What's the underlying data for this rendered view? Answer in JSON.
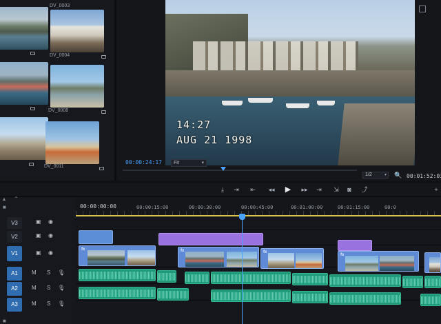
{
  "bin": {
    "items": [
      {
        "label": "",
        "image": "harbor-houses"
      },
      {
        "label": "DV_0004",
        "image": "white-houses-street"
      },
      {
        "label": "",
        "image": "harbor-boats"
      },
      {
        "label": "DV_0008",
        "image": "coastline"
      },
      {
        "label": "",
        "image": "beach-people"
      },
      {
        "label": "DV_0011",
        "image": "child-on-beach"
      }
    ],
    "top_label": "DV_0003"
  },
  "monitor": {
    "overlay_time": "14:27",
    "overlay_date": "AUG 21 1998",
    "current_timecode": "00:00:24:17",
    "zoom": "Fit",
    "quality": "1/2",
    "duration_timecode": "00:01:52:03",
    "playhead_fraction": 0.43
  },
  "timeline": {
    "current_timecode": "00:00:00:00",
    "ruler_labels": [
      "00:00:15:00",
      "00:00:30:00",
      "00:00:45:00",
      "00:01:00:00",
      "00:01:15:00",
      "00:0"
    ],
    "tracks": [
      {
        "label": "V3",
        "type": "video",
        "active": false
      },
      {
        "label": "V2",
        "type": "video",
        "active": false
      },
      {
        "label": "V1",
        "type": "video",
        "active": true
      },
      {
        "label": "A1",
        "type": "audio",
        "active": true
      },
      {
        "label": "A2",
        "type": "audio",
        "active": true
      },
      {
        "label": "A3",
        "type": "audio",
        "active": true
      }
    ],
    "mute_label": "M",
    "solo_label": "S"
  },
  "colors": {
    "accent": "#4aa3ff",
    "video_clip": "#5e8ad6",
    "graphic_clip": "#9a72e0",
    "audio_clip": "#1f9a7a",
    "work_area": "#d9c44a"
  },
  "icons": {
    "transport": [
      "mark-in-icon",
      "mark-out-icon",
      "go-to-in-icon",
      "step-back-icon",
      "play-icon",
      "step-forward-icon",
      "go-to-out-icon",
      "insert-icon",
      "camera-icon",
      "lift-icon"
    ]
  }
}
